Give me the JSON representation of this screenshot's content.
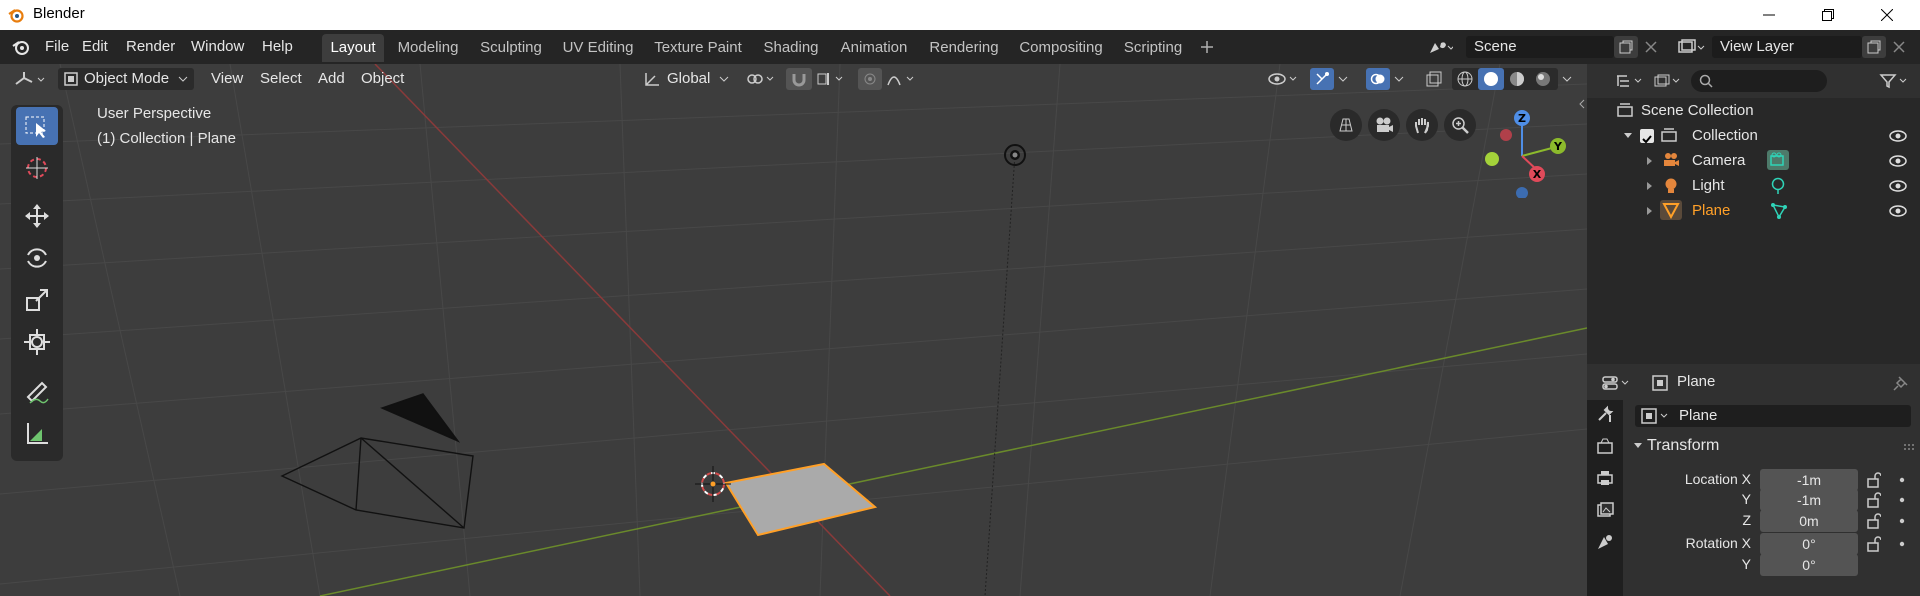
{
  "window": {
    "title": "Blender"
  },
  "menu": {
    "file": "File",
    "edit": "Edit",
    "render": "Render",
    "window": "Window",
    "help": "Help"
  },
  "workspaces": [
    "Layout",
    "Modeling",
    "Sculpting",
    "UV Editing",
    "Texture Paint",
    "Shading",
    "Animation",
    "Rendering",
    "Compositing",
    "Scripting"
  ],
  "scene": {
    "name": "Scene"
  },
  "view_layer": {
    "name": "View Layer"
  },
  "viewport": {
    "mode": "Object Mode",
    "menus": {
      "view": "View",
      "select": "Select",
      "add": "Add",
      "object": "Object"
    },
    "orientation": "Global",
    "perspective": "User Perspective",
    "context": "(1) Collection | Plane",
    "gizmo": {
      "z": "Z",
      "y": "Y",
      "x": "X"
    }
  },
  "outliner": {
    "root": "Scene Collection",
    "collection": "Collection",
    "items": [
      {
        "name": "Camera"
      },
      {
        "name": "Light"
      },
      {
        "name": "Plane"
      }
    ]
  },
  "properties": {
    "object_name": "Plane",
    "data_name": "Plane",
    "section": "Transform",
    "location_label": "Location X",
    "y_label": "Y",
    "z_label": "Z",
    "rotation_label": "Rotation X",
    "location": {
      "x": "-1m",
      "y": "-1m",
      "z": "0m"
    },
    "rotation": {
      "x": "0°",
      "y": "0°"
    }
  },
  "colors": {
    "accent": "#4772b3",
    "selected": "#ffa028",
    "x_axis": "#9c3a3a",
    "y_axis": "#6a8a2b"
  }
}
